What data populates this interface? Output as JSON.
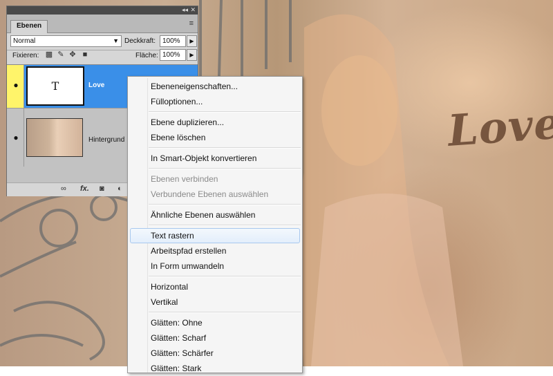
{
  "panel": {
    "collapse_icon": "double-chevron-right",
    "close_icon": "close",
    "tab_label": "Ebenen",
    "menu_icon": "panel-menu",
    "blend_mode": "Normal",
    "opacity_label": "Deckkraft:",
    "opacity_value": "100%",
    "lock_label": "Fixieren:",
    "fill_label": "Fläche:",
    "fill_value": "100%",
    "lock_icons": [
      "lock-transparent-pixels-icon",
      "lock-image-pixels-icon",
      "lock-position-icon",
      "lock-all-icon"
    ],
    "layers": [
      {
        "name": "Love",
        "thumb_text": "T",
        "selected": true
      },
      {
        "name": "Hintergrund",
        "selected": false
      }
    ],
    "bottom_icons": [
      "link-layers-icon",
      "fx-icon",
      "mask-icon",
      "adjustment-icon"
    ],
    "fx_glyph": "fx."
  },
  "canvas": {
    "text_layer": "Love"
  },
  "context_menu": {
    "items": [
      {
        "label": "Ebeneneigenschaften...",
        "enabled": true
      },
      {
        "label": "Fülloptionen...",
        "enabled": true
      },
      {
        "separator": true
      },
      {
        "label": "Ebene duplizieren...",
        "enabled": true
      },
      {
        "label": "Ebene löschen",
        "enabled": true
      },
      {
        "separator": true
      },
      {
        "label": "In Smart-Objekt konvertieren",
        "enabled": true
      },
      {
        "separator": true
      },
      {
        "label": "Ebenen verbinden",
        "enabled": false
      },
      {
        "label": "Verbundene Ebenen auswählen",
        "enabled": false
      },
      {
        "separator": true
      },
      {
        "label": "Ähnliche Ebenen auswählen",
        "enabled": true
      },
      {
        "separator": true
      },
      {
        "label": "Text rastern",
        "enabled": true,
        "hovered": true
      },
      {
        "label": "Arbeitspfad erstellen",
        "enabled": true
      },
      {
        "label": "In Form umwandeln",
        "enabled": true
      },
      {
        "separator": true
      },
      {
        "label": "Horizontal",
        "enabled": true
      },
      {
        "label": "Vertikal",
        "enabled": true
      },
      {
        "separator": true
      },
      {
        "label": "Glätten: Ohne",
        "enabled": true
      },
      {
        "label": "Glätten: Scharf",
        "enabled": true
      },
      {
        "label": "Glätten: Schärfer",
        "enabled": true
      },
      {
        "label": "Glätten: Stark",
        "enabled": true
      }
    ]
  }
}
